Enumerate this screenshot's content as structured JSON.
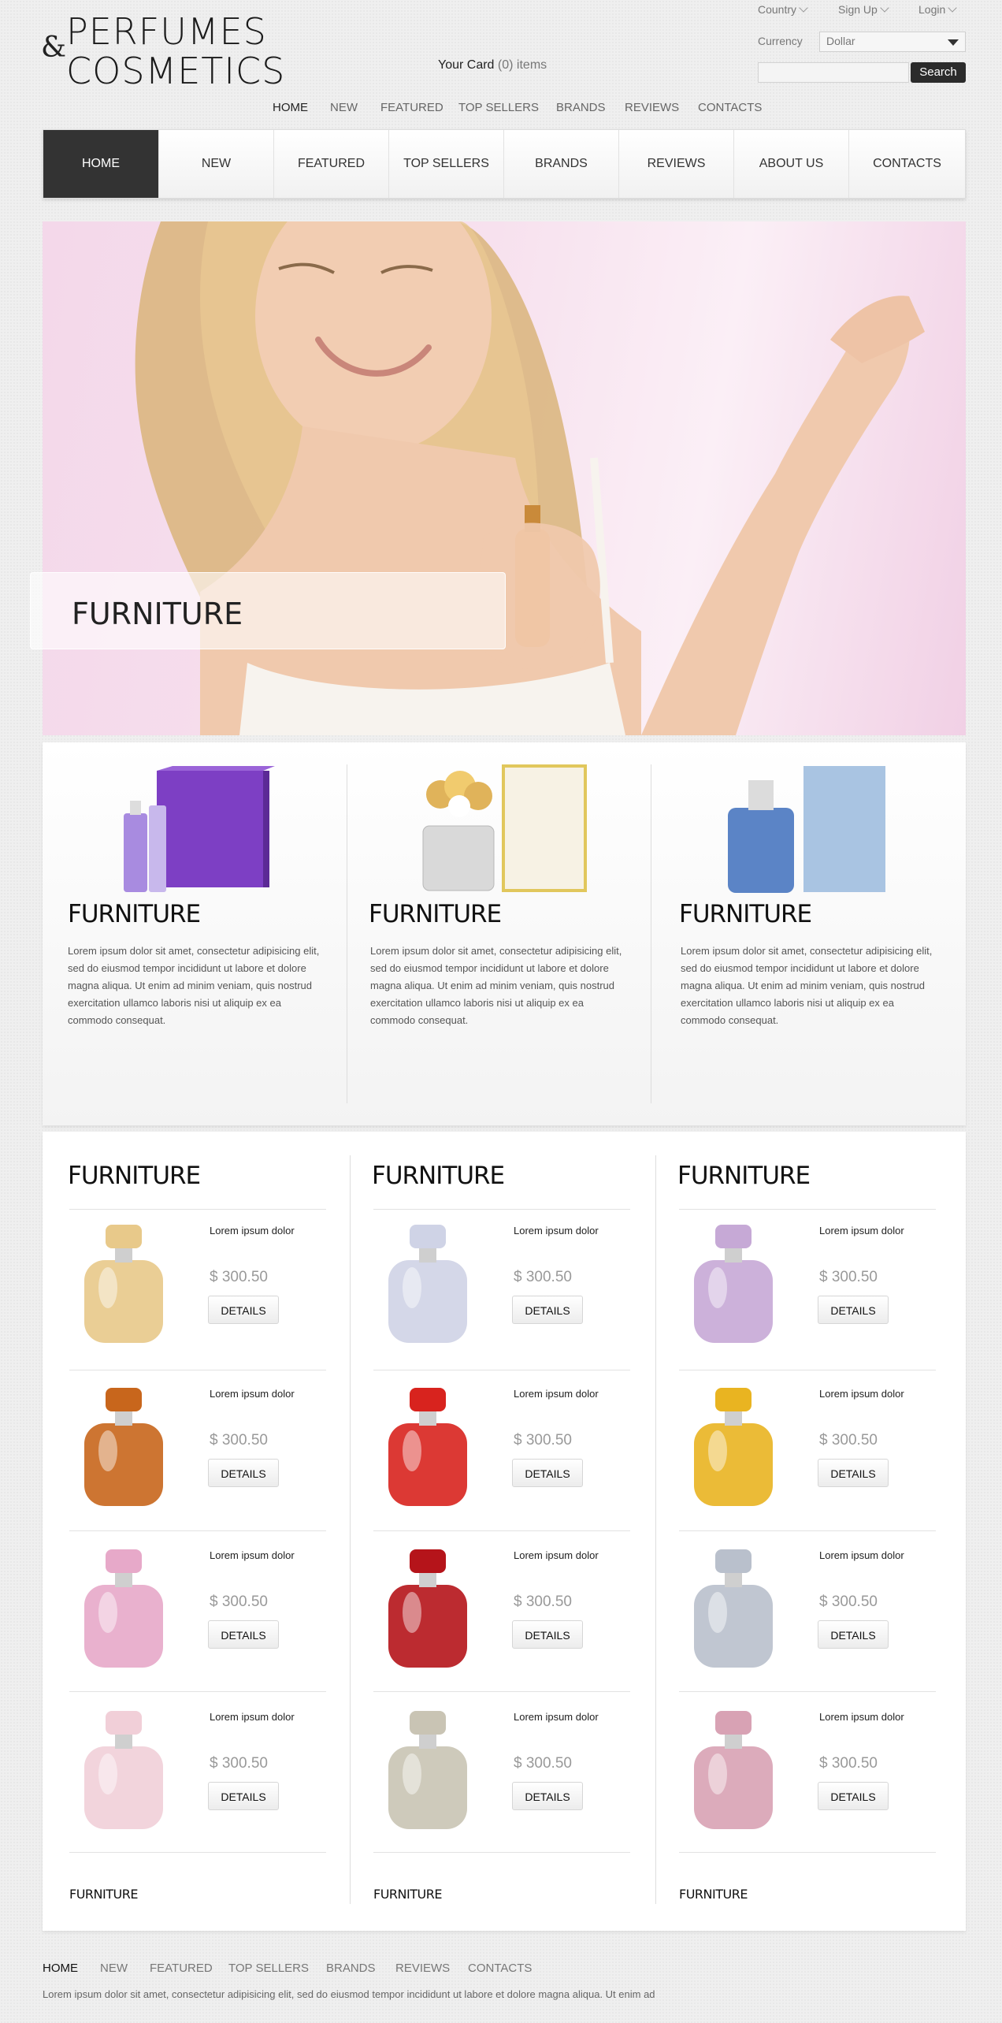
{
  "logo": {
    "ampersand": "&",
    "line1": "PERFUMES",
    "line2": "COSMETICS"
  },
  "cart": {
    "label": "Your Card",
    "count": "(0)",
    "items": "items"
  },
  "toplinks": [
    "Country",
    "Sign Up",
    "Login"
  ],
  "currency": {
    "label": "Currency",
    "value": "Dollar"
  },
  "search": {
    "button": "Search",
    "placeholder": ""
  },
  "topnav": [
    "HOME",
    "NEW",
    "FEATURED",
    "TOP SELLERS",
    "BRANDS",
    "REVIEWS",
    "CONTACTS"
  ],
  "mainnav": [
    "HOME",
    "NEW",
    "FEATURED",
    "TOP SELLERS",
    "BRANDS",
    "REVIEWS",
    "ABOUT US",
    "CONTACTS"
  ],
  "hero": {
    "caption": "FURNITURE"
  },
  "features": [
    {
      "title": "FURNITURE",
      "text": "Lorem ipsum dolor sit amet, consectetur adipisicing elit, sed do eiusmod tempor incididunt ut labore et dolore magna aliqua. Ut enim ad minim veniam, quis nostrud exercitation ullamco laboris nisi ut aliquip ex ea commodo consequat."
    },
    {
      "title": "FURNITURE",
      "text": "Lorem ipsum dolor sit amet, consectetur adipisicing elit, sed do eiusmod tempor incididunt ut labore et dolore magna aliqua. Ut enim ad minim veniam, quis nostrud exercitation ullamco laboris nisi ut aliquip ex ea commodo consequat."
    },
    {
      "title": "FURNITURE",
      "text": "Lorem ipsum dolor sit amet, consectetur adipisicing elit, sed do eiusmod tempor incididunt ut labore et dolore magna aliqua. Ut enim ad minim veniam, quis nostrud exercitation ullamco laboris nisi ut aliquip ex ea commodo consequat."
    }
  ],
  "products": {
    "columns": [
      {
        "title": "FURNITURE",
        "footer": "FURNITURE",
        "items": [
          {
            "name": "Lorem ipsum dolor",
            "price": "$ 300.50",
            "button": "DETAILS",
            "icon": "perfume-bottle-icon",
            "color": "#e8c98a"
          },
          {
            "name": "Lorem ipsum dolor",
            "price": "$ 300.50",
            "button": "DETAILS",
            "icon": "perfume-bottle-icon",
            "color": "#c8661c"
          },
          {
            "name": "Lorem ipsum dolor",
            "price": "$ 300.50",
            "button": "DETAILS",
            "icon": "perfume-bottle-icon",
            "color": "#e7a9c9"
          },
          {
            "name": "Lorem ipsum dolor",
            "price": "$ 300.50",
            "button": "DETAILS",
            "icon": "perfume-bottle-icon",
            "color": "#f1cfd8"
          }
        ]
      },
      {
        "title": "FURNITURE",
        "footer": "FURNITURE",
        "items": [
          {
            "name": "Lorem ipsum dolor",
            "price": "$ 300.50",
            "button": "DETAILS",
            "icon": "perfume-bottle-icon",
            "color": "#cfd3e6"
          },
          {
            "name": "Lorem ipsum dolor",
            "price": "$ 300.50",
            "button": "DETAILS",
            "icon": "perfume-bottle-icon",
            "color": "#d8231e"
          },
          {
            "name": "Lorem ipsum dolor",
            "price": "$ 300.50",
            "button": "DETAILS",
            "icon": "perfume-bottle-icon",
            "color": "#b5141a"
          },
          {
            "name": "Lorem ipsum dolor",
            "price": "$ 300.50",
            "button": "DETAILS",
            "icon": "perfume-bottle-icon",
            "color": "#c9c4b4"
          }
        ]
      },
      {
        "title": "FURNITURE",
        "footer": "FURNITURE",
        "items": [
          {
            "name": "Lorem ipsum dolor",
            "price": "$ 300.50",
            "button": "DETAILS",
            "icon": "perfume-bottle-icon",
            "color": "#c6a9d6"
          },
          {
            "name": "Lorem ipsum dolor",
            "price": "$ 300.50",
            "button": "DETAILS",
            "icon": "perfume-bottle-icon",
            "color": "#e9b421"
          },
          {
            "name": "Lorem ipsum dolor",
            "price": "$ 300.50",
            "button": "DETAILS",
            "icon": "perfume-bottle-icon",
            "color": "#b9c0cc"
          },
          {
            "name": "Lorem ipsum dolor",
            "price": "$ 300.50",
            "button": "DETAILS",
            "icon": "perfume-bottle-icon",
            "color": "#d8a2b4"
          }
        ]
      }
    ]
  },
  "footer": {
    "nav": [
      "HOME",
      "NEW",
      "FEATURED",
      "TOP SELLERS",
      "BRANDS",
      "REVIEWS",
      "CONTACTS"
    ],
    "text": "Lorem ipsum dolor sit amet, consectetur adipisicing elit, sed do eiusmod tempor incididunt ut labore et dolore magna aliqua. Ut enim ad"
  }
}
